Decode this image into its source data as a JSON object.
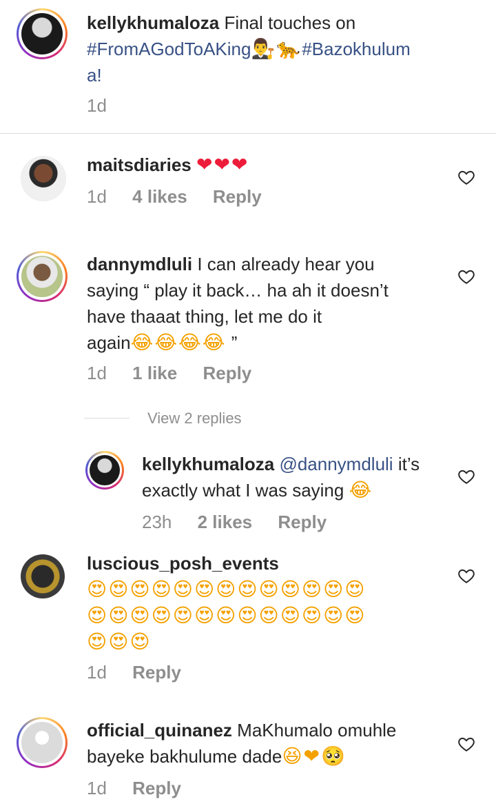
{
  "caption": {
    "username": "kellykhumaloza",
    "text_part1": "Final touches on",
    "hashtag1": "#FromAGodToAKing",
    "emoji1": "👨‍⚖️🐆",
    "hashtag2": "#Bazokhulum",
    "text_part2": "a!",
    "time": "1d"
  },
  "comments": [
    {
      "username": "maitsdiaries",
      "text": "",
      "emoji": "❤❤❤",
      "time": "1d",
      "likes": "4 likes",
      "reply": "Reply"
    },
    {
      "username": "dannymdluli",
      "line1": "I can already hear you",
      "line2": "saying “ play it back… ha ah it doesn’t",
      "line3": "have thaaat thing, let me do it",
      "line4": "again",
      "emoji": "😂😂😂😂",
      "close_quote": " ”",
      "time": "1d",
      "likes": "1 like",
      "reply": "Reply",
      "view_replies": "View 2 replies"
    },
    {
      "username": "kellykhumaloza",
      "mention": "@dannymdluli",
      "line1": "it’s",
      "line2": "exactly what I was saying",
      "emoji": "😂",
      "time": "23h",
      "likes": "2 likes",
      "reply": "Reply"
    },
    {
      "username": "luscious_posh_events",
      "emoji_row1": "😍😍😍😍😍😍😍😍😍😍😍😍😍",
      "emoji_row2": "😍😍😍😍😍😍😍😍😍😍😍😍😍",
      "emoji_row3": "😍😍😍",
      "time": "1d",
      "reply": "Reply"
    },
    {
      "username": "official_quinanez",
      "line1": "MaKhumalo omuhle",
      "line2": "bayeke bakhulume dade",
      "emoji": "😆❤🥺",
      "time": "1d",
      "reply": "Reply"
    }
  ],
  "colors": {
    "text": "#262626",
    "muted": "#8e8e8e",
    "link": "#385185",
    "heart_red": "#ed1c3a",
    "divider": "#dbdbdb"
  },
  "icons": [
    "heart-outline-icon",
    "avatar-ring"
  ]
}
